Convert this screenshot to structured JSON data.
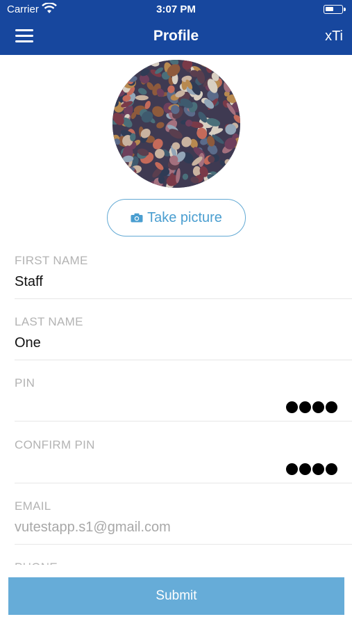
{
  "status": {
    "carrier": "Carrier",
    "time": "3:07 PM"
  },
  "nav": {
    "title": "Profile",
    "right": "xTi"
  },
  "avatar": {
    "take_picture_label": "Take picture"
  },
  "fields": {
    "first_name": {
      "label": "FIRST NAME",
      "value": "Staff"
    },
    "last_name": {
      "label": "LAST NAME",
      "value": "One"
    },
    "pin": {
      "label": "PIN",
      "masked_length": 4
    },
    "confirm_pin": {
      "label": "CONFIRM PIN",
      "masked_length": 4
    },
    "email": {
      "label": "EMAIL",
      "value": "vutestapp.s1@gmail.com"
    },
    "phone": {
      "label": "PHONE"
    }
  },
  "submit_label": "Submit",
  "colors": {
    "header": "#17479e",
    "accent": "#4a9ed0",
    "submit": "#66acd8"
  }
}
